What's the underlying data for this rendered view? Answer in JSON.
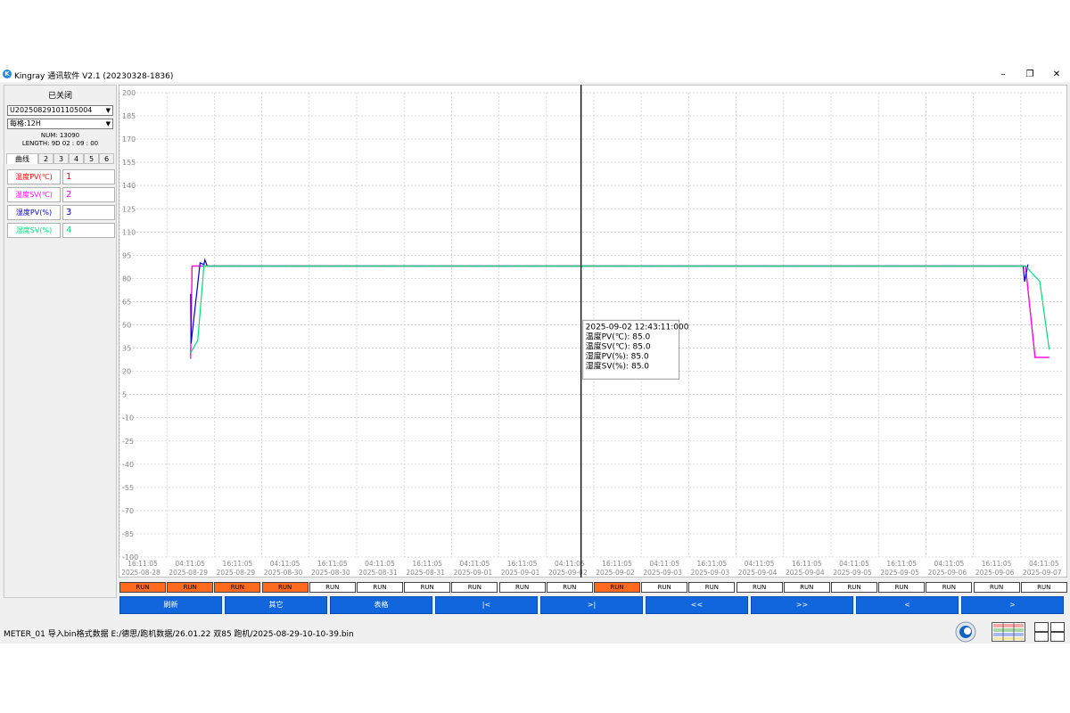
{
  "window": {
    "title": "Kingray 通讯软件 V2.1 (20230328-1836)",
    "icon": "app-logo-icon",
    "controls": [
      "minimize-icon",
      "maximize-icon",
      "close-icon"
    ]
  },
  "sidebar": {
    "status": "已关闭",
    "device_select": "U20250829101105004",
    "interval_select": "每格:12H",
    "num": "NUM: 13090",
    "length": "LENGTH: 9D 02 : 09 : 00",
    "tabs": [
      "曲线",
      "2",
      "3",
      "4",
      "5",
      "6"
    ],
    "legend": [
      {
        "name": "温度PV(℃)",
        "num": "1",
        "color": "#ff0000"
      },
      {
        "name": "温度SV(℃)",
        "num": "2",
        "color": "#ff00ff"
      },
      {
        "name": "湿度PV(%)",
        "num": "3",
        "color": "#0000cc"
      },
      {
        "name": "湿度SV(%)",
        "num": "4",
        "color": "#00dd77"
      }
    ]
  },
  "chart_data": {
    "type": "line",
    "ylim": [
      -100,
      200
    ],
    "yticks": [
      200,
      185,
      170,
      155,
      140,
      125,
      110,
      95,
      80,
      65,
      50,
      35,
      20,
      5,
      -10,
      -25,
      -40,
      -55,
      -70,
      -85,
      -100
    ],
    "x_labels": [
      [
        "16:11:05",
        "2025-08-28"
      ],
      [
        "04:11:05",
        "2025-08-29"
      ],
      [
        "16:11:05",
        "2025-08-29"
      ],
      [
        "04:11:05",
        "2025-08-30"
      ],
      [
        "16:11:05",
        "2025-08-30"
      ],
      [
        "04:11:05",
        "2025-08-31"
      ],
      [
        "16:11:05",
        "2025-08-31"
      ],
      [
        "04:11:05",
        "2025-09-01"
      ],
      [
        "16:11:05",
        "2025-09-01"
      ],
      [
        "04:11:05",
        "2025-09-02"
      ],
      [
        "16:11:05",
        "2025-09-02"
      ],
      [
        "04:11:05",
        "2025-09-03"
      ],
      [
        "16:11:05",
        "2025-09-03"
      ],
      [
        "04:11:05",
        "2025-09-04"
      ],
      [
        "16:11:05",
        "2025-09-04"
      ],
      [
        "04:11:05",
        "2025-09-05"
      ],
      [
        "16:11:05",
        "2025-09-05"
      ],
      [
        "04:11:05",
        "2025-09-06"
      ],
      [
        "16:11:05",
        "2025-09-06"
      ],
      [
        "04:11:05",
        "2025-09-07"
      ]
    ],
    "series": [
      {
        "name": "温度PV(℃)",
        "color": "#ff0000",
        "points": [
          [
            1.5,
            30
          ],
          [
            1.53,
            88
          ],
          [
            1.85,
            88
          ],
          [
            19.1,
            88
          ],
          [
            19.3,
            29
          ],
          [
            19.6,
            29
          ]
        ]
      },
      {
        "name": "温度SV(℃)",
        "color": "#ff00ff",
        "points": [
          [
            1.5,
            28
          ],
          [
            1.53,
            88
          ],
          [
            1.85,
            88
          ],
          [
            19.1,
            88
          ],
          [
            19.3,
            29
          ],
          [
            19.6,
            29
          ]
        ]
      },
      {
        "name": "湿度PV(%)",
        "color": "#0000cc",
        "points": [
          [
            1.5,
            70
          ],
          [
            1.51,
            38
          ],
          [
            1.7,
            90
          ],
          [
            1.78,
            89
          ],
          [
            1.8,
            92
          ],
          [
            1.85,
            88
          ],
          [
            19.05,
            88
          ],
          [
            19.08,
            78
          ],
          [
            19.15,
            89
          ]
        ]
      },
      {
        "name": "湿度SV(%)",
        "color": "#00dd77",
        "points": [
          [
            1.5,
            32
          ],
          [
            1.65,
            40
          ],
          [
            1.78,
            88
          ],
          [
            19.1,
            88
          ],
          [
            19.4,
            78
          ],
          [
            19.6,
            34
          ]
        ]
      }
    ],
    "cursor_x": 9.73,
    "tooltip": {
      "time": "2025-09-02 12:43:11:000",
      "lines": [
        "温度PV(℃): 85.0",
        "温度SV(℃): 85.0",
        "湿度PV(%): 85.0",
        "湿度SV(%): 85.0"
      ]
    },
    "grid": true
  },
  "run_row": {
    "label": "RUN",
    "active": [
      true,
      true,
      true,
      true,
      false,
      false,
      false,
      false,
      false,
      false,
      true,
      false,
      false,
      false,
      false,
      false,
      false,
      false,
      false,
      false
    ]
  },
  "buttons": [
    "刷新",
    "其它",
    "表格",
    "|<",
    ">|",
    "<<",
    ">>",
    "<",
    ">"
  ],
  "statusbar": {
    "text": "METER_01 导入bin格式数据 E:/德思/跑机数据/26.01.22 双85 跑机/2025-08-29-10-10-39.bin",
    "icons": [
      "logo-icon",
      "table-view-icon",
      "grid-view-icon"
    ]
  }
}
